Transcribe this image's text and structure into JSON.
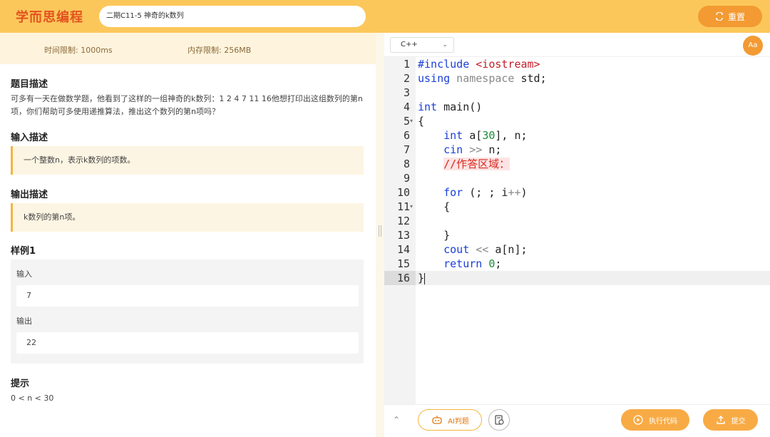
{
  "header": {
    "logo": "学而思编程",
    "title": "二期C11-5 神奇的k数列",
    "reset_label": "重置"
  },
  "limits": {
    "time": "时间限制: 1000ms",
    "memory": "内存限制: 256MB"
  },
  "problem": {
    "desc_title": "题目描述",
    "desc_text": "可多有一天在做数学题，他看到了这样的一组神奇的k数列：1 2 4 7 11 16他想打印出这组数列的第n项，你们帮助可多使用递推算法，推出这个数列的第n项吗？",
    "input_title": "输入描述",
    "input_text": "一个整数n，表示k数列的项数。",
    "output_title": "输出描述",
    "output_text": "k数列的第n项。",
    "sample_title": "样例1",
    "sample_in_label": "输入",
    "sample_in_value": "7",
    "sample_out_label": "输出",
    "sample_out_value": "22",
    "hint_title": "提示",
    "hint_text": "0 < n < 30"
  },
  "editor": {
    "language": "C++",
    "font_button": "Aa",
    "line_numbers": [
      "1",
      "2",
      "3",
      "4",
      "5",
      "6",
      "7",
      "8",
      "9",
      "10",
      "11",
      "12",
      "13",
      "14",
      "15",
      "16"
    ],
    "code": {
      "l1_a": "#include ",
      "l1_b": "<iostream>",
      "l2_a": "using",
      "l2_b": " namespace",
      "l2_c": " std;",
      "l4_a": "int",
      "l4_b": " main()",
      "l5": "{",
      "l6_a": "    int",
      "l6_b": " a[",
      "l6_c": "30",
      "l6_d": "], n;",
      "l7_a": "    cin",
      "l7_b": " >>",
      "l7_c": " n;",
      "l8": "//作答区域：",
      "l10_a": "    for",
      "l10_b": " (; ; i",
      "l10_c": "++",
      "l10_d": ")",
      "l11": "    {",
      "l13": "    }",
      "l14_a": "    cout",
      "l14_b": " <<",
      "l14_c": " a[n];",
      "l15_a": "    return",
      "l15_b": " 0",
      "l15_c": ";",
      "l16": "}"
    }
  },
  "footer": {
    "ai_label": "AI判题",
    "run_label": "执行代码",
    "submit_label": "提交"
  },
  "colors": {
    "header_bg": "#fcc75a",
    "logo": "#e2531f",
    "accent": "#f39a33",
    "keyword": "#1a3fd6",
    "string": "#c0202a",
    "number": "#1a8a3a",
    "comment": "#d9281e"
  }
}
